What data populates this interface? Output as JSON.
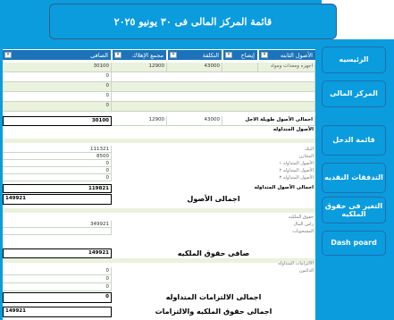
{
  "title": "قائمة المركز المالى فى ٣٠ يونيو ٢٠٢٥",
  "nav": [
    "الرئيسيه",
    "المركز المالى",
    "قائمة الدخل",
    "التدفقات النقديه",
    "التغير فى حقوق الملكيه",
    "Dash poard"
  ],
  "headers": {
    "asset": "الأصول الثابته",
    "depreciation_rate": "إيضاح",
    "cost": "التكلفة",
    "acc_dep": "مجمع الإهلاك",
    "net": "الصافى"
  },
  "fixed_assets": [
    {
      "label": "اجهزه ومعدات ومواد",
      "net": "30100",
      "acc": "12900",
      "cost": "43000"
    },
    {
      "net": "0"
    },
    {
      "net": "0"
    },
    {
      "net": "0"
    },
    {
      "net": "0"
    }
  ],
  "long_term_total": {
    "label": "اجمالى الأصول طويلة الاجل",
    "net": "30100",
    "acc": "12900",
    "cost": "43000"
  },
  "current_assets_heading": "الأصول المتداوله",
  "current_assets": [
    {
      "label": "البنك",
      "value": "111321"
    },
    {
      "label": "المخازن",
      "value": "8500"
    },
    {
      "label": "الأصول المتداوله ١",
      "value": "0"
    },
    {
      "label": "الأصول المتداوله ٢",
      "value": "0"
    },
    {
      "label": "الأصول المتداوله ٣",
      "value": "0"
    }
  ],
  "current_total": {
    "label": "اجمالى الأصول المتداوله",
    "value": "119821"
  },
  "assets_total": {
    "label": "اجمالى الأصول",
    "value": "149921"
  },
  "equity_heading": "حقوق الملكيه",
  "equity": [
    {
      "label": "راس المال",
      "value": "349921"
    },
    {
      "label": "المسحوبات",
      "value": ""
    }
  ],
  "equity_net": {
    "label": "صافى حقوق الملكيه",
    "value": "149921"
  },
  "liabilities_heading": "الالتزامات المتداوله",
  "liabilities": [
    {
      "label": "الدائنون",
      "value": "0"
    },
    {
      "label": "",
      "value": "0"
    },
    {
      "label": "",
      "value": "0"
    }
  ],
  "liabilities_total": {
    "label": "اجمالى الالتزامات المتداوله",
    "value": "0"
  },
  "grand_total": {
    "label": "اجمالى حقوق الملكيه والالتزامات",
    "value": "149921"
  }
}
